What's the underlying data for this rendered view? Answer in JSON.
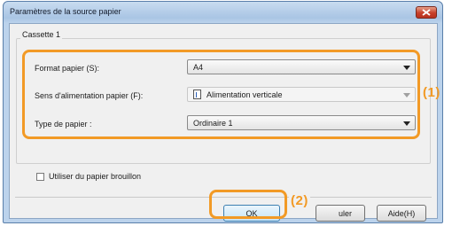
{
  "window": {
    "title": "Paramètres de la source papier"
  },
  "group": {
    "label": "Cassette 1"
  },
  "rows": [
    {
      "label": "Format papier (S):",
      "value": "A4"
    },
    {
      "label": "Sens d'alimentation papier (F):",
      "value": "Alimentation verticale"
    },
    {
      "label": "Type de papier :",
      "value": "Ordinaire 1"
    }
  ],
  "checkbox": {
    "label": "Utiliser du papier brouillon",
    "checked": false
  },
  "buttons": {
    "ok": "OK",
    "cancel_visible": "uler",
    "help": "Aide(H)"
  },
  "callouts": {
    "one": "(1)",
    "two": "(2)"
  },
  "colors": {
    "highlight": "#f29a26",
    "titlebar": "#a9c5e4"
  }
}
